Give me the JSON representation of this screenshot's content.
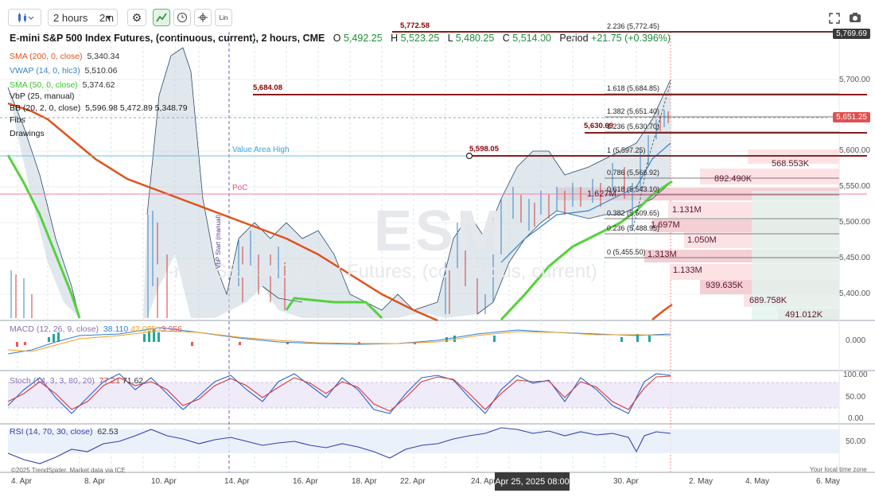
{
  "toolbar": {
    "interval": "2 hours",
    "interval_alt": "2m",
    "lin_label": "Lin"
  },
  "title": {
    "instrument": "E-mini S&P 500 Index Futures, (continuous, current), 2 hours, CME",
    "o_label": "O",
    "o_value": "5,492.25",
    "h_label": "H",
    "h_value": "5,523.25",
    "l_label": "L",
    "l_value": "5,480.25",
    "c_label": "C",
    "c_value": "5,514.00",
    "period_label": "Period",
    "period_value": "+21.75 (+0.396%)"
  },
  "indicators": [
    {
      "name": "SMA (200, 0, close)",
      "value": "5,340.34",
      "color": "#e0521c"
    },
    {
      "name": "VWAP (14, 0, hlc3)",
      "value": "5,510.06",
      "color": "#3b82c6"
    },
    {
      "name": "SMA (50, 0, close)",
      "value": "5,374.62",
      "color": "#3cc42c"
    },
    {
      "name": "VbP (25, manual)",
      "value": "",
      "color": "#333333"
    },
    {
      "name": "BB (20, 2, 0, close)",
      "value": "5,596.98  5,472.89  5,348.79",
      "color": "#333333"
    },
    {
      "name": "Fibs",
      "value": "",
      "color": "#333333"
    },
    {
      "name": "Drawings",
      "value": "",
      "color": "#333333"
    }
  ],
  "watermark": {
    "symbol": "ESM",
    "name": "E-mini S&P 500 Index Futures, (continuous, current)"
  },
  "price_axis": [
    "5,700.00",
    "5,650.00",
    "5,600.00",
    "5,550.00",
    "5,500.00",
    "5,450.00",
    "5,400.00"
  ],
  "price_tags": {
    "top": "5,769.69",
    "current": "5,651.25"
  },
  "levels": {
    "l1": "5,772.58",
    "l2": "5,684.08",
    "l3": "5,630.69",
    "l4": "5,598.05",
    "vah": "Value Area High",
    "poc": "PoC",
    "vbp_start": "VbP Start (manual)"
  },
  "fibs": [
    "2.236 (5,772.45)",
    "1.618 (5,684.85)",
    "1.382 (5,651.40)",
    "1.236 (5,630.70)",
    "1 (5,597.25)",
    "0.786 (5,566.92)",
    "0.618 (5,543.10)",
    "0.382 (5,509.65)",
    "0.236 (5,488.95)",
    "0 (5,455.50)"
  ],
  "volume_profile": [
    "568.553K",
    "892.490K",
    "1.627M",
    "1.131M",
    "1.697M",
    "1.050M",
    "1.313M",
    "1.133M",
    "939.635K",
    "689.758K",
    "491.012K"
  ],
  "macd": {
    "name": "MACD (12, 26, 9, close)",
    "v1": "38.110",
    "v2": "42.065",
    "v3": "-3.956",
    "axis": "0.000"
  },
  "stoch": {
    "name": "Stoch (14, 3, 3, 80, 20)",
    "v1": "77.21",
    "v2": "71.62",
    "axis": [
      "100.00",
      "50.00",
      "0.00"
    ]
  },
  "rsi": {
    "name": "RSI (14, 70, 30, close)",
    "value": "62.53",
    "axis": "50.00"
  },
  "dates": [
    "4. Apr",
    "8. Apr",
    "10. Apr",
    "14. Apr",
    "16. Apr",
    "18. Apr",
    "22. Apr",
    "24. Apr",
    "30. Apr",
    "2. May",
    "4. May",
    "6. May"
  ],
  "date_cursor": "Apr 25, 2025 08:00",
  "footer": {
    "credit": "©2025 TrendSpider. Market data via ICE",
    "timezone": "Your local time zone"
  }
}
